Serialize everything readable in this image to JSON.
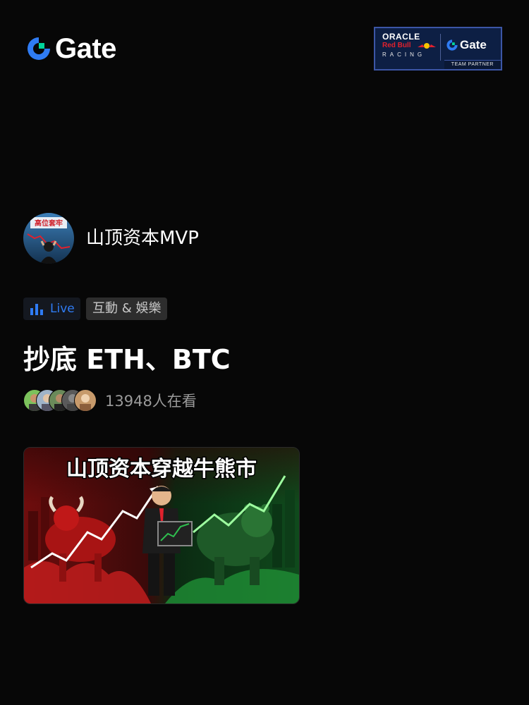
{
  "header": {
    "brand_name": "Gate",
    "logo_icon": "gate-logo-icon",
    "partner_badge": {
      "oracle_text": "ORACLE",
      "redbull_text": "Red Bull",
      "racing_text": "RACING",
      "gate_text": "Gate",
      "team_partner_text": "TEAM PARTNER"
    }
  },
  "stream": {
    "avatar_caption": "高位套牢",
    "streamer_name": "山顶资本MVP",
    "live_label": "Live",
    "live_icon": "live-bars-icon",
    "category": "互動 & 娛樂",
    "title": "抄底 ETH、BTC",
    "viewer_count_text": "13948人在看",
    "thumbnail_text": "山顶资本穿越牛熊市"
  },
  "colors": {
    "background": "#070707",
    "accent_blue": "#2f7cf4",
    "brand_green": "#00d69b",
    "bull_red": "#e0212d",
    "bear_green": "#2fbf4f"
  }
}
